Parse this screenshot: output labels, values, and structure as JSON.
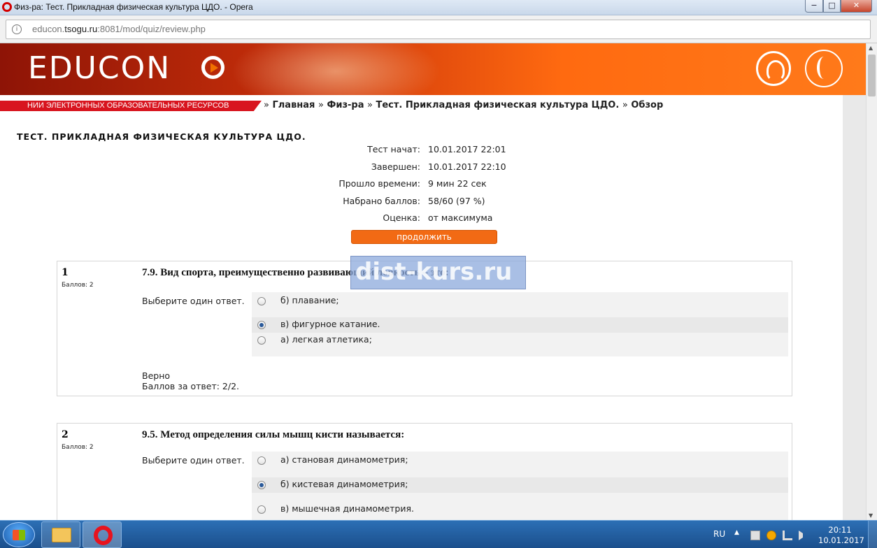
{
  "window": {
    "title": "Физ-ра: Тест. Прикладная физическая культура ЦДО. - Opera",
    "minimize": "−",
    "maximize": "□",
    "close": "✕"
  },
  "address": {
    "prefix": "educon.",
    "host": "tsogu.ru",
    "rest": ":8081/mod/quiz/review.php"
  },
  "site": {
    "logo": "EDUCON",
    "subtitle": "НИИ ЭЛЕКТРОННЫХ ОБРАЗОВАТЕЛЬНЫХ РЕСУРСОВ"
  },
  "breadcrumb": {
    "sep": "»",
    "items": [
      "Главная",
      "Физ-ра",
      "Тест. Прикладная физическая культура ЦДО.",
      "Обзор"
    ]
  },
  "quiz": {
    "title": "ТЕСТ. ПРИКЛАДНАЯ ФИЗИЧЕСКАЯ КУЛЬТУРА ЦДО.",
    "summary": [
      {
        "label": "Тест начат:",
        "value": "10.01.2017 22:01"
      },
      {
        "label": "Завершен:",
        "value": "10.01.2017 22:10"
      },
      {
        "label": "Прошло времени:",
        "value": "9 мин 22 сек"
      },
      {
        "label": "Набрано баллов:",
        "value": "58/60 (97 %)"
      },
      {
        "label": "Оценка:",
        "value": "от максимума"
      }
    ],
    "continue_label": "продолжить"
  },
  "questions": [
    {
      "number": "1",
      "points": "Баллов: 2",
      "text": "7.9. Вид спорта, преимущественно развивающий ловкость – это:",
      "prompt": "Выберите один ответ.",
      "answers": [
        {
          "text": "б) плавание;",
          "checked": false
        },
        {
          "text": "в) фигурное катание.",
          "checked": true
        },
        {
          "text": "а) легкая атлетика;",
          "checked": false
        }
      ],
      "feedback": "Верно",
      "score": "Баллов за ответ: 2/2."
    },
    {
      "number": "2",
      "points": "Баллов: 2",
      "text": "9.5. Метод определения силы мышц кисти называется:",
      "prompt": "Выберите один ответ.",
      "answers": [
        {
          "text": "а) становая динамометрия;",
          "checked": false
        },
        {
          "text": "б) кистевая динамометрия;",
          "checked": true
        },
        {
          "text": "в) мышечная динамометрия.",
          "checked": false
        }
      ]
    }
  ],
  "watermark": "dist-kurs.ru",
  "taskbar": {
    "lang": "RU",
    "time": "20:11",
    "date": "10.01.2017"
  }
}
